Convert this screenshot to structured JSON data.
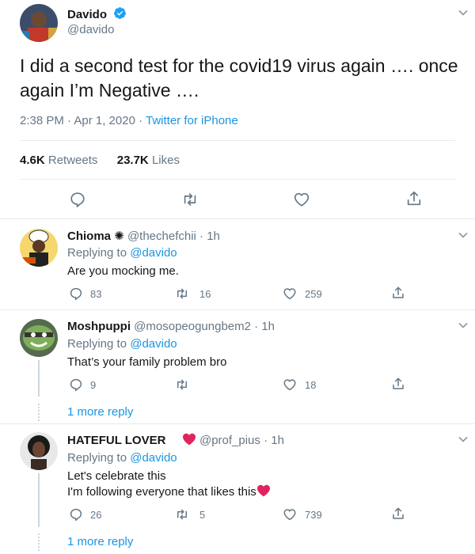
{
  "main_tweet": {
    "name": "Davido",
    "handle": "@davido",
    "text": "I did a second  test for the covid19 virus again …. once again I’m Negative ….",
    "timestamp": "2:38 PM · Apr 1, 2020 ·",
    "source": "Twitter for iPhone",
    "retweets_count": "4.6K",
    "retweets_label": "Retweets",
    "likes_count": "23.7K",
    "likes_label": "Likes"
  },
  "replies": [
    {
      "name": "Chioma",
      "handle": "@thechefchii · 1h",
      "replying_prefix": "Replying to",
      "replying_to": "@davido",
      "text_lines": [
        "Are you mocking me."
      ],
      "reply_count": "83",
      "retweet_count": "16",
      "like_count": "259"
    },
    {
      "name": "Moshpuppi",
      "handle": "@mosopeogungbem2 · 1h",
      "replying_prefix": "Replying to",
      "replying_to": "@davido",
      "text_lines": [
        "That’s your family problem bro"
      ],
      "reply_count": "9",
      "retweet_count": "",
      "like_count": "18",
      "more_replies": "1 more reply"
    },
    {
      "name": "HATEFUL LOVER",
      "handle": "@prof_pius · 1h",
      "replying_prefix": "Replying to",
      "replying_to": "@davido",
      "text_lines": [
        "Let's celebrate this",
        "I'm following everyone that likes this"
      ],
      "reply_count": "26",
      "retweet_count": "5",
      "like_count": "739",
      "more_replies": "1 more reply"
    }
  ],
  "colors": {
    "link": "#1b95e0",
    "muted": "#657786",
    "divider": "#e6ecf0",
    "heart": "#e0245e"
  }
}
